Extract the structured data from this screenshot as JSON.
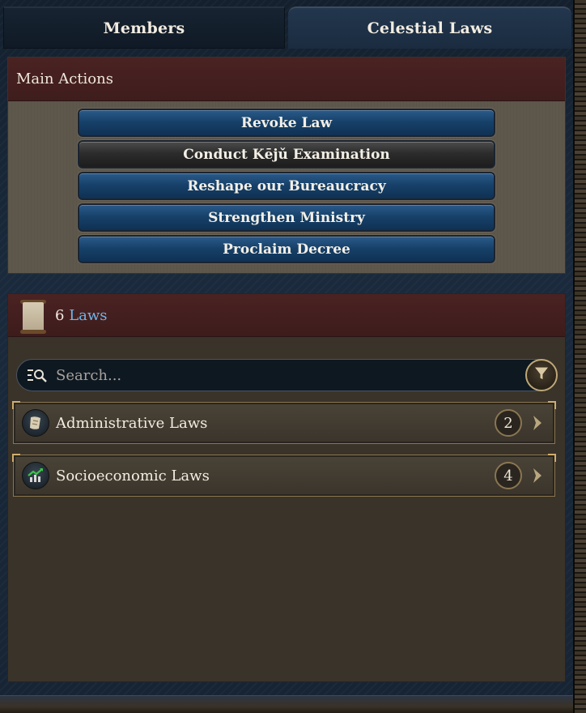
{
  "tabs": [
    {
      "label": "Members",
      "active": false
    },
    {
      "label": "Celestial Laws",
      "active": true
    }
  ],
  "main_actions": {
    "title": "Main Actions",
    "buttons": [
      {
        "label": "Revoke Law",
        "style": "blue"
      },
      {
        "label": "Conduct Kējǔ Examination",
        "style": "dark"
      },
      {
        "label": "Reshape our Bureaucracy",
        "style": "blue"
      },
      {
        "label": "Strengthen Ministry",
        "style": "blue"
      },
      {
        "label": "Proclaim Decree",
        "style": "blue"
      }
    ]
  },
  "laws": {
    "count": "6",
    "count_label": "Laws",
    "icon": "scroll-icon",
    "search": {
      "placeholder": "Search...",
      "value": ""
    },
    "categories": [
      {
        "label": "Administrative Laws",
        "count": "2",
        "icon": "quill-scroll-icon"
      },
      {
        "label": "Socioeconomic Laws",
        "count": "4",
        "icon": "growth-chart-icon"
      }
    ]
  },
  "colors": {
    "accent": "#6fb6ea",
    "header_red": "#4a2222",
    "button_blue": "#17416a",
    "gold_trim": "#cfae6c"
  }
}
